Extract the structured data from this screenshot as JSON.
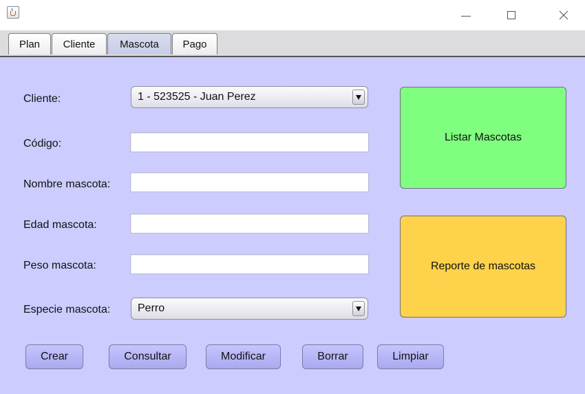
{
  "window": {
    "icon": "java-cup-icon",
    "controls": [
      "minimize-icon",
      "maximize-icon",
      "close-icon"
    ]
  },
  "tabs": [
    {
      "label": "Plan",
      "selected": false
    },
    {
      "label": "Cliente",
      "selected": false
    },
    {
      "label": "Mascota",
      "selected": true
    },
    {
      "label": "Pago",
      "selected": false
    }
  ],
  "form": {
    "cliente_label": "Cliente:",
    "cliente_value": "1 - 523525 - Juan Perez",
    "codigo_label": "Código:",
    "codigo_value": "",
    "nombre_label": "Nombre mascota:",
    "nombre_value": "",
    "edad_label": "Edad mascota:",
    "edad_value": "",
    "peso_label": "Peso mascota:",
    "peso_value": "",
    "especie_label": "Especie mascota:",
    "especie_value": "Perro"
  },
  "side_buttons": {
    "listar": "Listar Mascotas",
    "reporte": "Reporte de mascotas"
  },
  "actions": {
    "crear": "Crear",
    "consultar": "Consultar",
    "modificar": "Modificar",
    "borrar": "Borrar",
    "limpiar": "Limpiar"
  },
  "colors": {
    "panel_bg": "#ccccff",
    "listar_bg": "#80fe80",
    "reporte_bg": "#fed24a",
    "action_btn_bg": "#b8b8f8"
  }
}
